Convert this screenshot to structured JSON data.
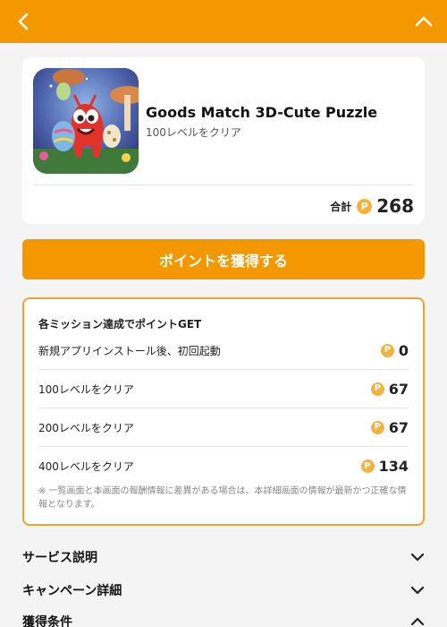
{
  "header": {
    "back_icon": "chevron-left-icon",
    "collapse_icon": "chevron-up-icon",
    "bg_color": "#f39800"
  },
  "app": {
    "title": "Goods Match 3D-Cute Puzzle",
    "subtitle": "100レベルをクリア",
    "total_label": "合計",
    "total_points": "268",
    "coin_symbol": "P"
  },
  "cta": {
    "label": "ポイントを獲得する"
  },
  "missions": {
    "title": "各ミッション達成でポイントGET",
    "items": [
      {
        "label": "新規アプリインストール後、初回起動",
        "points": "0"
      },
      {
        "label": "100レベルをクリア",
        "points": "67"
      },
      {
        "label": "200レベルをクリア",
        "points": "67"
      },
      {
        "label": "400レベルをクリア",
        "points": "134"
      }
    ],
    "note": "※ 一覧画面と本画面の報酬情報に差異がある場合は、本詳細画面の情報が最新かつ正確な情報となります。"
  },
  "sections": [
    {
      "label": "サービス説明",
      "icon": "chevron-down-icon"
    },
    {
      "label": "キャンペーン詳細",
      "icon": "chevron-down-icon"
    },
    {
      "label": "獲得条件",
      "icon": "chevron-up-icon"
    }
  ],
  "colors": {
    "accent": "#f39800",
    "coin": "#f3b23f",
    "border": "#f0a22a"
  }
}
